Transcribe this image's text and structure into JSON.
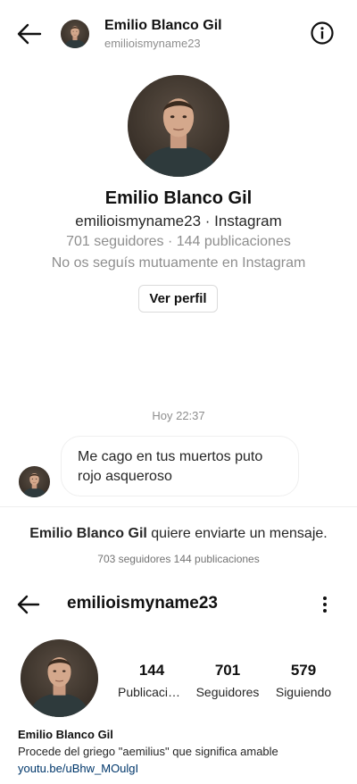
{
  "header": {
    "display_name": "Emilio Blanco Gil",
    "username": "emilioismyname23",
    "back_icon": "arrow-left-icon",
    "info_icon": "info-icon"
  },
  "profile_card": {
    "display_name": "Emilio Blanco Gil",
    "username_line": "emilioismyname23 · Instagram",
    "stats_line": "701 seguidores · 144 publicaciones",
    "mutual_line": "No os seguís mutuamente en Instagram",
    "view_profile_button": "Ver perfil"
  },
  "conversation": {
    "timestamp": "Hoy 22:37",
    "messages": [
      {
        "text": "Me cago en tus muertos puto rojo asqueroso"
      }
    ]
  },
  "request": {
    "sender": "Emilio Blanco Gil",
    "text": " quiere enviarte un mensaje.",
    "stats": "703 seguidores 144 publicaciones"
  },
  "profile_page": {
    "username": "emilioismyname23",
    "stats": [
      {
        "value": "144",
        "label": "Publicaciones"
      },
      {
        "value": "701",
        "label": "Seguidores"
      },
      {
        "value": "579",
        "label": "Siguiendo"
      }
    ],
    "bio_name": "Emilio Blanco Gil",
    "bio_text": "Procede del griego \"aemilius\" que significa amable",
    "bio_link": "youtu.be/uBhw_MOulgI"
  },
  "colors": {
    "text_primary": "#262626",
    "text_secondary": "#8e8e8e",
    "link": "#00376b",
    "border": "#dbdbdb"
  }
}
